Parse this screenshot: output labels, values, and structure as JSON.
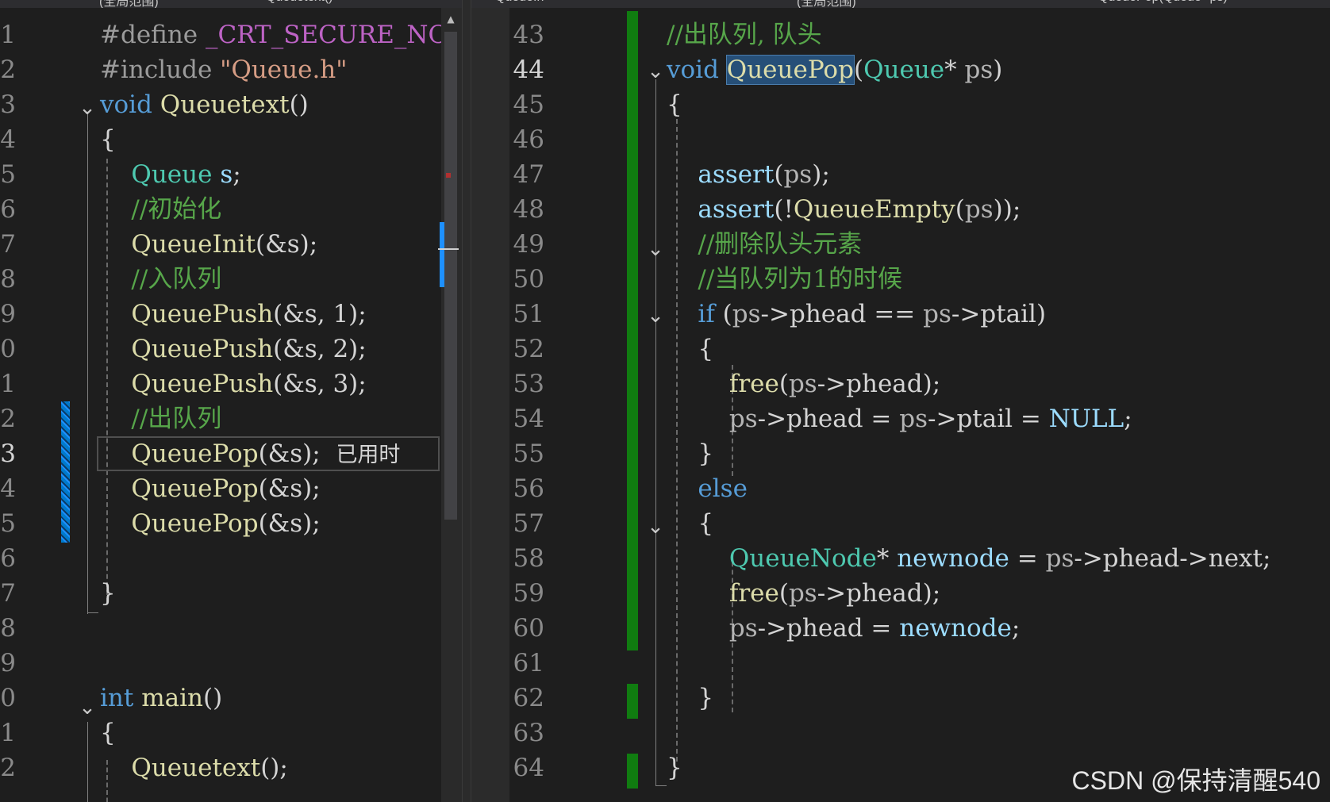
{
  "tabs": {
    "left": [
      "(全局范围)",
      "Queuetext()"
    ],
    "right": [
      "Queue.h",
      "(全局范围)",
      "QueuePop(Queue* ps)"
    ]
  },
  "left_editor": {
    "line_numbers": [
      "1",
      "2",
      "3",
      "4",
      "5",
      "6",
      "7",
      "8",
      "9",
      "0",
      "1",
      "2",
      "3",
      "4",
      "5",
      "6",
      "7",
      "8",
      "9",
      "0",
      "1",
      "2"
    ],
    "active_line_index": 12,
    "hint_text": "已用时"
  },
  "right_editor": {
    "line_numbers": [
      "43",
      "44",
      "45",
      "46",
      "47",
      "48",
      "49",
      "50",
      "51",
      "52",
      "53",
      "54",
      "55",
      "56",
      "57",
      "58",
      "59",
      "60",
      "61",
      "62",
      "63",
      "64"
    ],
    "active_line_index": 1
  },
  "watermark": "CSDN @保持清醒540",
  "colors": {
    "keyword": "#569cd6",
    "function": "#dcdcaa",
    "type": "#4ec9b0",
    "comment": "#57a64a",
    "string": "#d69d85",
    "change_bar": "#107c10",
    "selection": "#264f78"
  }
}
